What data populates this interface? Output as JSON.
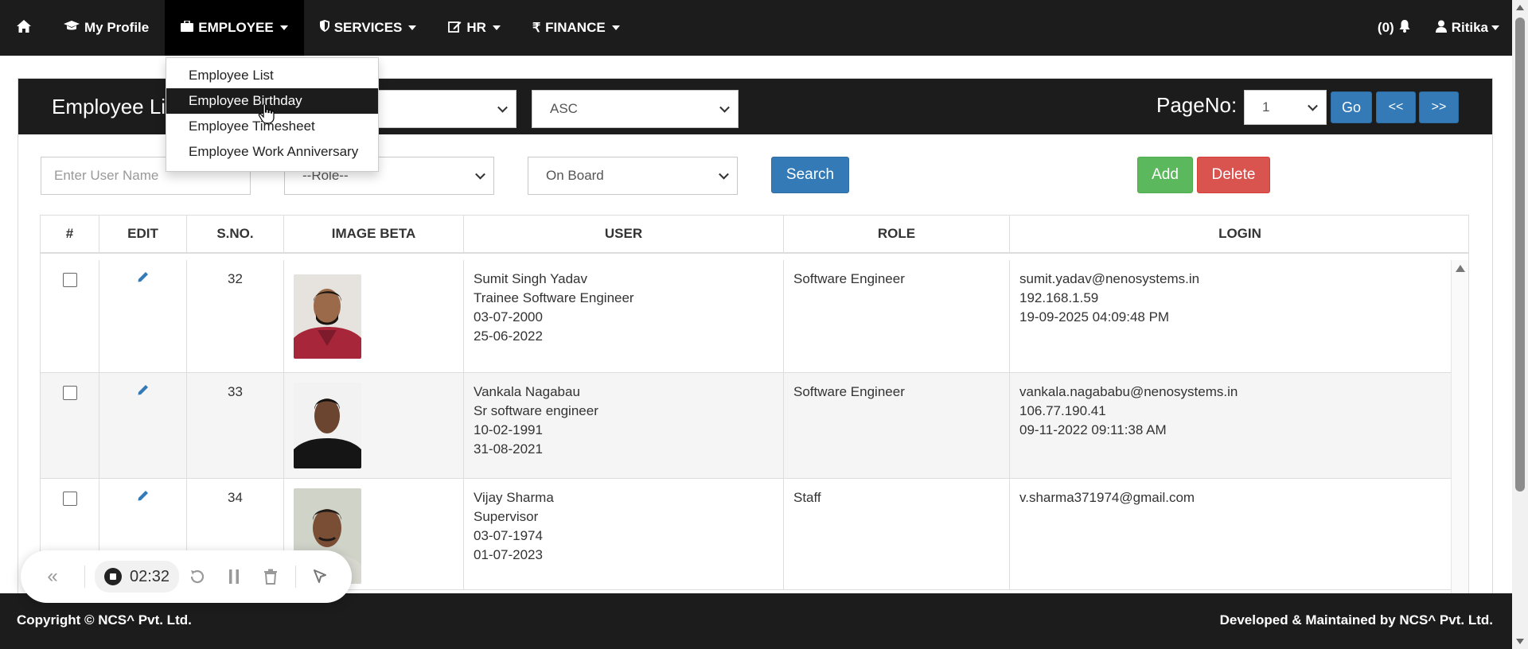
{
  "navbar": {
    "home_icon": "home-icon",
    "items": [
      {
        "label": "My Profile",
        "icon": "graduation-cap-icon"
      },
      {
        "label": "EMPLOYEE",
        "icon": "briefcase-icon"
      },
      {
        "label": "SERVICES",
        "icon": "shield-icon"
      },
      {
        "label": "HR",
        "icon": "edit-icon"
      },
      {
        "label": "FINANCE",
        "icon": "rupee-icon"
      }
    ],
    "notifications": "(0)",
    "user": "Ritika"
  },
  "employee_menu": {
    "items": [
      "Employee List",
      "Employee Birthday",
      "Employee Timesheet",
      "Employee Work Anniversary"
    ],
    "hovered": "Employee Birthday"
  },
  "panel": {
    "title": "Employee List",
    "sort_field": "",
    "sort_order": "ASC",
    "pageno_label": "PageNo:",
    "pageno_value": "1",
    "go": "Go",
    "prev": "<<",
    "next": ">>"
  },
  "filters": {
    "user_placeholder": "Enter User Name",
    "role": "--Role--",
    "status": "On Board",
    "search": "Search",
    "add": "Add",
    "delete": "Delete"
  },
  "table": {
    "headers": [
      "#",
      "EDIT",
      "S.NO.",
      "IMAGE BETA",
      "USER",
      "ROLE",
      "LOGIN"
    ],
    "rows": [
      {
        "sno": "32",
        "name": "Sumit Singh Yadav",
        "title": "Trainee Software Engineer",
        "dob": "03-07-2000",
        "doj": "25-06-2022",
        "role": "Software Engineer",
        "email": "sumit.yadav@nenosystems.in",
        "ip": "192.168.1.59",
        "last_login": "19-09-2025 04:09:48 PM"
      },
      {
        "sno": "33",
        "name": "Vankala Nagabau",
        "title": "Sr software engineer",
        "dob": "10-02-1991",
        "doj": "31-08-2021",
        "role": "Software Engineer",
        "email": "vankala.nagababu@nenosystems.in",
        "ip": "106.77.190.41",
        "last_login": "09-11-2022 09:11:38 AM"
      },
      {
        "sno": "34",
        "name": "Vijay Sharma",
        "title": "Supervisor",
        "dob": "03-07-1974",
        "doj": "01-07-2023",
        "role": "Staff",
        "email": "v.sharma371974@gmail.com",
        "ip": "",
        "last_login": ""
      }
    ]
  },
  "recorder": {
    "time": "02:32"
  },
  "footer": {
    "left": "Copyright © NCS^ Pvt. Ltd.",
    "right": "Developed & Maintained by NCS^ Pvt. Ltd."
  },
  "colors": {
    "nav_bg": "#1c1c1c",
    "primary": "#337ab7",
    "success": "#5cb85c",
    "danger": "#d9534f"
  }
}
